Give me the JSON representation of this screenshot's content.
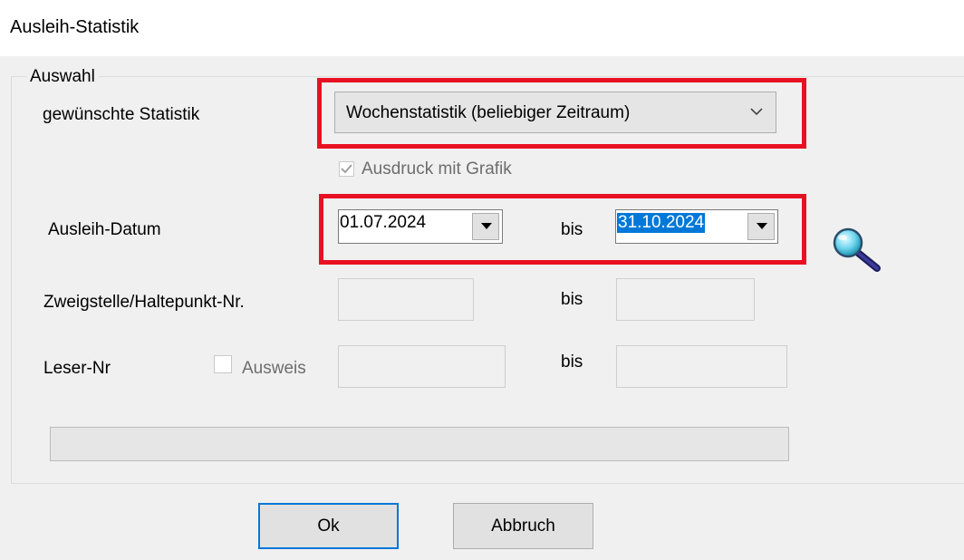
{
  "window": {
    "title": "Ausleih-Statistik"
  },
  "group": {
    "legend": "Auswahl"
  },
  "statistik": {
    "label": "gewünschte Statistik",
    "selected": "Wochenstatistik (beliebiger Zeitraum)"
  },
  "grafik": {
    "label": "Ausdruck mit Grafik",
    "checked": true,
    "enabled": false
  },
  "ausleih_datum": {
    "label": "Ausleih-Datum",
    "from": "01.07.2024",
    "to_label": "bis",
    "to": "31.10.2024"
  },
  "zweigstelle": {
    "label": "Zweigstelle/Haltepunkt-Nr.",
    "from": "",
    "to_label": "bis",
    "to": ""
  },
  "leser": {
    "label": "Leser-Nr",
    "ausweis_label": "Ausweis",
    "ausweis_checked": false,
    "from": "",
    "to_label": "bis",
    "to": ""
  },
  "buttons": {
    "ok": "Ok",
    "cancel": "Abbruch"
  },
  "icons": {
    "search": "magnifier-icon",
    "dropdown": "chevron-down-icon"
  },
  "colors": {
    "highlight": "#e81123",
    "selection": "#0078d7"
  }
}
